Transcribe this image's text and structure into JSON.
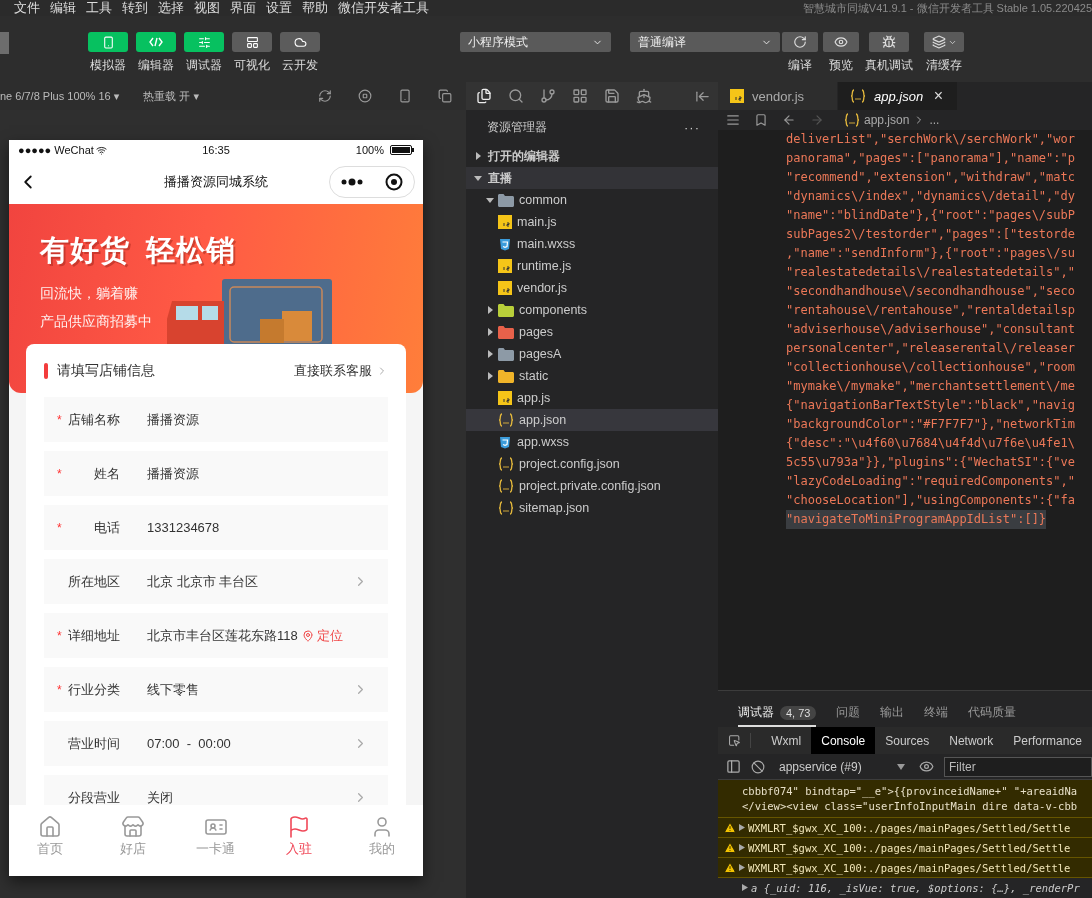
{
  "menu_bar": {
    "items": [
      "文件",
      "编辑",
      "工具",
      "转到",
      "选择",
      "视图",
      "界面",
      "设置",
      "帮助",
      "微信开发者工具"
    ],
    "title": "智慧城市同城V41.9.1 - 微信开发者工具 Stable 1.05.220425"
  },
  "toolbar": {
    "modes": [
      {
        "label": "模拟器",
        "selected": true
      },
      {
        "label": "编辑器",
        "selected": true
      },
      {
        "label": "调试器",
        "selected": true
      },
      {
        "label": "可视化",
        "selected": false
      },
      {
        "label": "云开发",
        "selected": false
      }
    ],
    "mode_select": "小程序模式",
    "compile_select": "普通编译",
    "actions": [
      "编译",
      "预览",
      "真机调试",
      "清缓存"
    ]
  },
  "simulator_bar": {
    "device": "ne 6/7/8 Plus 100% 16 ▾",
    "hot_reload": "热重载 开 ▾"
  },
  "phone": {
    "status": {
      "carrier": "●●●●● WeChat",
      "time": "16:35",
      "battery": "100%"
    },
    "nav_title": "播播资源同城系统",
    "banner": {
      "headline": [
        "有好货",
        "轻松销"
      ],
      "lines": [
        "回流快，躺着赚",
        "产品供应商招募中"
      ]
    },
    "form": {
      "title": "请填写店铺信息",
      "contact": "直接联系客服",
      "required_mark": "*",
      "rows": [
        {
          "label": "店铺名称",
          "value": "播播资源",
          "required": true,
          "chevron": false
        },
        {
          "label": "姓名",
          "value": "播播资源",
          "required": true,
          "chevron": false
        },
        {
          "label": "电话",
          "value": "1331234678",
          "required": true,
          "chevron": false
        },
        {
          "label": "所在地区",
          "value": "北京 北京市 丰台区",
          "required": false,
          "chevron": true
        },
        {
          "label": "详细地址",
          "value": "北京市丰台区莲花东路118",
          "required": true,
          "chevron": false,
          "action": "定位"
        },
        {
          "label": "行业分类",
          "value": "线下零售",
          "required": true,
          "chevron": true
        },
        {
          "label": "营业时间",
          "value": "07:00  -  00:00",
          "required": false,
          "chevron": true
        },
        {
          "label": "分段营业",
          "value": "关闭",
          "required": false,
          "chevron": true
        }
      ]
    },
    "tabbar": [
      {
        "label": "首页",
        "selected": false
      },
      {
        "label": "好店",
        "selected": false
      },
      {
        "label": "一卡通",
        "selected": false
      },
      {
        "label": "入驻",
        "selected": true
      },
      {
        "label": "我的",
        "selected": false
      }
    ]
  },
  "explorer": {
    "title": "资源管理器",
    "more": "···",
    "sections": [
      {
        "label": "打开的编辑器",
        "expanded": false
      },
      {
        "label": "直播",
        "expanded": true,
        "children": [
          {
            "name": "common",
            "kind": "folder",
            "color": "#8d9aa6",
            "expanded": true,
            "selected": false,
            "children": [
              {
                "name": "main.js",
                "kind": "js",
                "selected": false
              },
              {
                "name": "main.wxss",
                "kind": "wxss",
                "selected": false
              },
              {
                "name": "runtime.js",
                "kind": "js",
                "selected": false
              },
              {
                "name": "vendor.js",
                "kind": "js",
                "selected": false
              }
            ]
          },
          {
            "name": "components",
            "kind": "folder",
            "color": "#b9cf3a",
            "expanded": false,
            "selected": false
          },
          {
            "name": "pages",
            "kind": "folder",
            "color": "#e8614a",
            "expanded": false,
            "selected": false
          },
          {
            "name": "pagesA",
            "kind": "folder",
            "color": "#8d9aa6",
            "expanded": false,
            "selected": false
          },
          {
            "name": "static",
            "kind": "folder",
            "color": "#f0b429",
            "expanded": false,
            "selected": false
          },
          {
            "name": "app.js",
            "kind": "js",
            "selected": false
          },
          {
            "name": "app.json",
            "kind": "json",
            "selected": true
          },
          {
            "name": "app.wxss",
            "kind": "wxss",
            "selected": false
          },
          {
            "name": "project.config.json",
            "kind": "json",
            "selected": false
          },
          {
            "name": "project.private.config.json",
            "kind": "json",
            "selected": false
          },
          {
            "name": "sitemap.json",
            "kind": "json",
            "selected": false
          }
        ]
      }
    ]
  },
  "editor": {
    "tabs": [
      {
        "label": "vendor.js",
        "kind": "js",
        "selected": false
      },
      {
        "label": "app.json",
        "kind": "json",
        "selected": true
      }
    ],
    "close_glyph": "×",
    "breadcrumb": {
      "file": "app.json",
      "rest": "..."
    },
    "code_lines": [
      {
        "text": "deliverList\",\"serchWork\\/serchWork\",\"wor",
        "selected": false
      },
      {
        "text": "panorama\",\"pages\":[\"panorama\"],\"name\":\"p",
        "selected": false
      },
      {
        "text": "\"recommend\",\"extension\",\"withdraw\",\"matc",
        "selected": false
      },
      {
        "text": "\"dynamics\\/index\",\"dynamics\\/detail\",\"dy",
        "selected": false
      },
      {
        "text": "\"name\":\"blindDate\"},{\"root\":\"pages\\/subP",
        "selected": false
      },
      {
        "text": "subPages2\\/testorder\",\"pages\":[\"testorde",
        "selected": false
      },
      {
        "text": ",\"name\":\"sendInform\"},{\"root\":\"pages\\/su",
        "selected": false
      },
      {
        "text": "\"realestatedetails\\/realestatedetails\",\"",
        "selected": false
      },
      {
        "text": "\"secondhandhouse\\/secondhandhouse\",\"seco",
        "selected": false
      },
      {
        "text": "\"rentahouse\\/rentahouse\",\"rentaldetailsp",
        "selected": false
      },
      {
        "text": "\"adviserhouse\\/adviserhouse\",\"consultant",
        "selected": false
      },
      {
        "text": "personalcenter\",\"releaserental\\/releaser",
        "selected": false
      },
      {
        "text": "\"collectionhouse\\/collectionhouse\",\"room",
        "selected": false
      },
      {
        "text": "\"mymake\\/mymake\",\"merchantsettlement\\/me",
        "selected": false
      },
      {
        "text": "{\"navigationBarTextStyle\":\"black\",\"navig",
        "selected": false
      },
      {
        "text": "\"backgroundColor\":\"#F7F7F7\"},\"networkTim",
        "selected": false
      },
      {
        "text": "{\"desc\":\"\\u4f60\\u7684\\u4f4d\\u7f6e\\u4fe1\\",
        "selected": false
      },
      {
        "text": "5c55\\u793a\"}},\"plugins\":{\"WechatSI\":{\"ve",
        "selected": false
      },
      {
        "text": "\"lazyCodeLoading\":\"requiredComponents\",\"",
        "selected": false
      },
      {
        "text": "\"chooseLocation\"],\"usingComponents\":{\"fa",
        "selected": false
      },
      {
        "text": "\"navigateToMiniProgramAppIdList\":[]}",
        "selected": true
      }
    ]
  },
  "debugger": {
    "tabs": [
      {
        "label": "调试器",
        "badge": "4, 73",
        "selected": true
      },
      {
        "label": "问题",
        "selected": false
      },
      {
        "label": "输出",
        "selected": false
      },
      {
        "label": "终端",
        "selected": false
      },
      {
        "label": "代码质量",
        "selected": false
      }
    ],
    "devtools_tabs": [
      {
        "label": "Wxml",
        "selected": false
      },
      {
        "label": "Console",
        "selected": true
      },
      {
        "label": "Sources",
        "selected": false
      },
      {
        "label": "Network",
        "selected": false
      },
      {
        "label": "Performance",
        "selected": false
      }
    ],
    "context": "appservice (#9)",
    "filter_placeholder": "Filter",
    "logs": [
      {
        "kind": "source",
        "text": "cbbbf074\" bindtap=\"__e\">{{provinceidName+\" \"+areaidNa"
      },
      {
        "kind": "source",
        "text": "</view><view class=\"userInfoInputMain dire data-v-cbb"
      },
      {
        "kind": "warning",
        "text": "WXMLRT_$gwx_XC_100:./pages/mainPages/Settled/Settle"
      },
      {
        "kind": "warning",
        "text": "WXMLRT_$gwx_XC_100:./pages/mainPages/Settled/Settle"
      },
      {
        "kind": "warning",
        "text": "WXMLRT_$gwx_XC_100:./pages/mainPages/Settled/Settle"
      },
      {
        "kind": "log",
        "text": "a {_uid: 116, _isVue: true, $options: {…}, _renderPr"
      }
    ]
  }
}
